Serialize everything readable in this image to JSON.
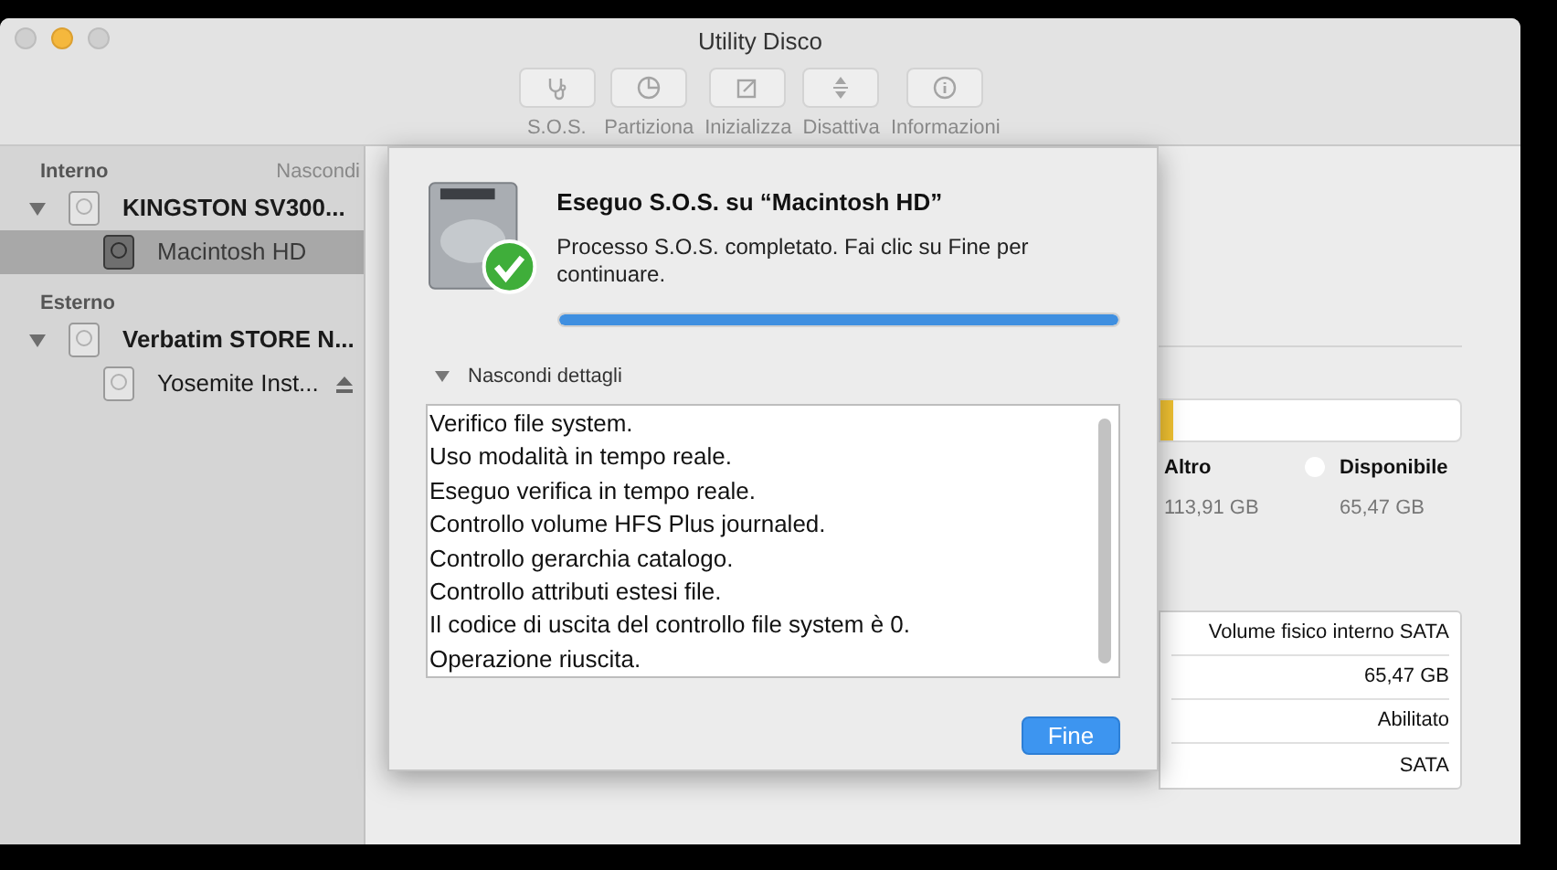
{
  "window": {
    "title": "Utility Disco"
  },
  "toolbar": [
    {
      "label": "S.O.S.",
      "kind": "sos",
      "disabled": true
    },
    {
      "label": "Partiziona",
      "kind": "partition",
      "disabled": true
    },
    {
      "label": "Inizializza",
      "kind": "erase",
      "disabled": true
    },
    {
      "label": "Disattiva",
      "kind": "unmount",
      "disabled": true
    },
    {
      "label": "Informazioni",
      "kind": "info",
      "disabled": true
    }
  ],
  "sidebar": {
    "sections": [
      {
        "title": "Interno",
        "action": "Nascondi",
        "items": [
          {
            "label": "KINGSTON SV300...",
            "expanded": true,
            "selected": false,
            "children": [
              {
                "label": "Macintosh HD",
                "selected": true,
                "ejectable": false
              }
            ]
          }
        ]
      },
      {
        "title": "Esterno",
        "items": [
          {
            "label": "Verbatim STORE N...",
            "expanded": true,
            "selected": false,
            "children": [
              {
                "label": "Yosemite Inst...",
                "selected": false,
                "ejectable": true
              }
            ]
          }
        ]
      }
    ]
  },
  "storage": {
    "level": 0.04,
    "legend": [
      {
        "label": "Altro",
        "size": "113,91 GB"
      },
      {
        "label": "Disponibile",
        "size": "65,47 GB",
        "color": "#ffffff"
      }
    ]
  },
  "info_values": [
    "Volume fisico interno SATA",
    "65,47 GB",
    "Abilitato",
    "SATA"
  ],
  "sheet": {
    "title": "Eseguo S.O.S. su “Macintosh HD”",
    "message": "Processo S.O.S. completato. Fai clic su Fine per continuare.",
    "progress": {
      "level": 1
    },
    "details": {
      "label": "Nascondi dettagli",
      "expanded": true,
      "lines": [
        "Verifico file system.",
        "Uso modalità in tempo reale.",
        "Eseguo verifica in tempo reale.",
        "Controllo volume HFS Plus journaled.",
        "Controllo gerarchia catalogo.",
        "Controllo attributi estesi file.",
        "Il codice di uscita del controllo file system è 0.",
        "Operazione riuscita."
      ]
    },
    "button": "Fine"
  }
}
